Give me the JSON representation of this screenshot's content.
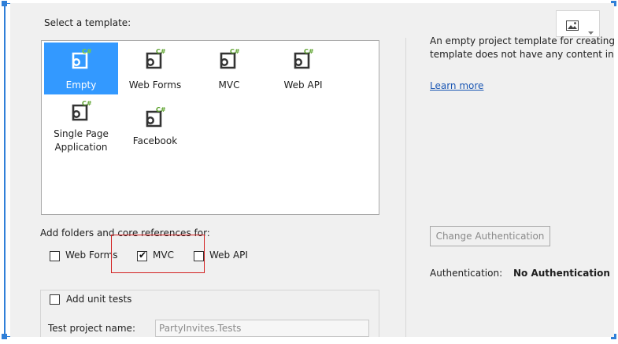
{
  "select_template_label": "Select a template:",
  "templates": [
    {
      "name": "Empty",
      "selected": true
    },
    {
      "name": "Web Forms",
      "selected": false
    },
    {
      "name": "MVC",
      "selected": false
    },
    {
      "name": "Web API",
      "selected": false
    },
    {
      "name": "Single Page Application",
      "line1": "Single Page",
      "line2": "Application",
      "selected": false
    },
    {
      "name": "Facebook",
      "selected": false
    }
  ],
  "template_icon_badge": "C#",
  "description": {
    "line1": "An empty project template for creating",
    "line2": "template does not have any content in",
    "learn_more": "Learn more"
  },
  "add_folders": {
    "label": "Add folders and core references for:",
    "options": [
      {
        "label": "Web Forms",
        "checked": false
      },
      {
        "label": "MVC",
        "checked": true
      },
      {
        "label": "Web API",
        "checked": false
      }
    ]
  },
  "unit_tests": {
    "label": "Add unit tests",
    "checked": false
  },
  "test_project": {
    "label": "Test project name:",
    "value": "PartyInvites.Tests"
  },
  "authentication": {
    "button": "Change Authentication",
    "label": "Authentication:",
    "value": "No Authentication"
  },
  "colors": {
    "accent": "#3399ff",
    "highlight_box": "#d21f1f",
    "link": "#1a56b3",
    "selection_frame": "#2f7fd8"
  },
  "toolbar_icons": [
    "image-icon",
    "chevron-down-icon"
  ]
}
